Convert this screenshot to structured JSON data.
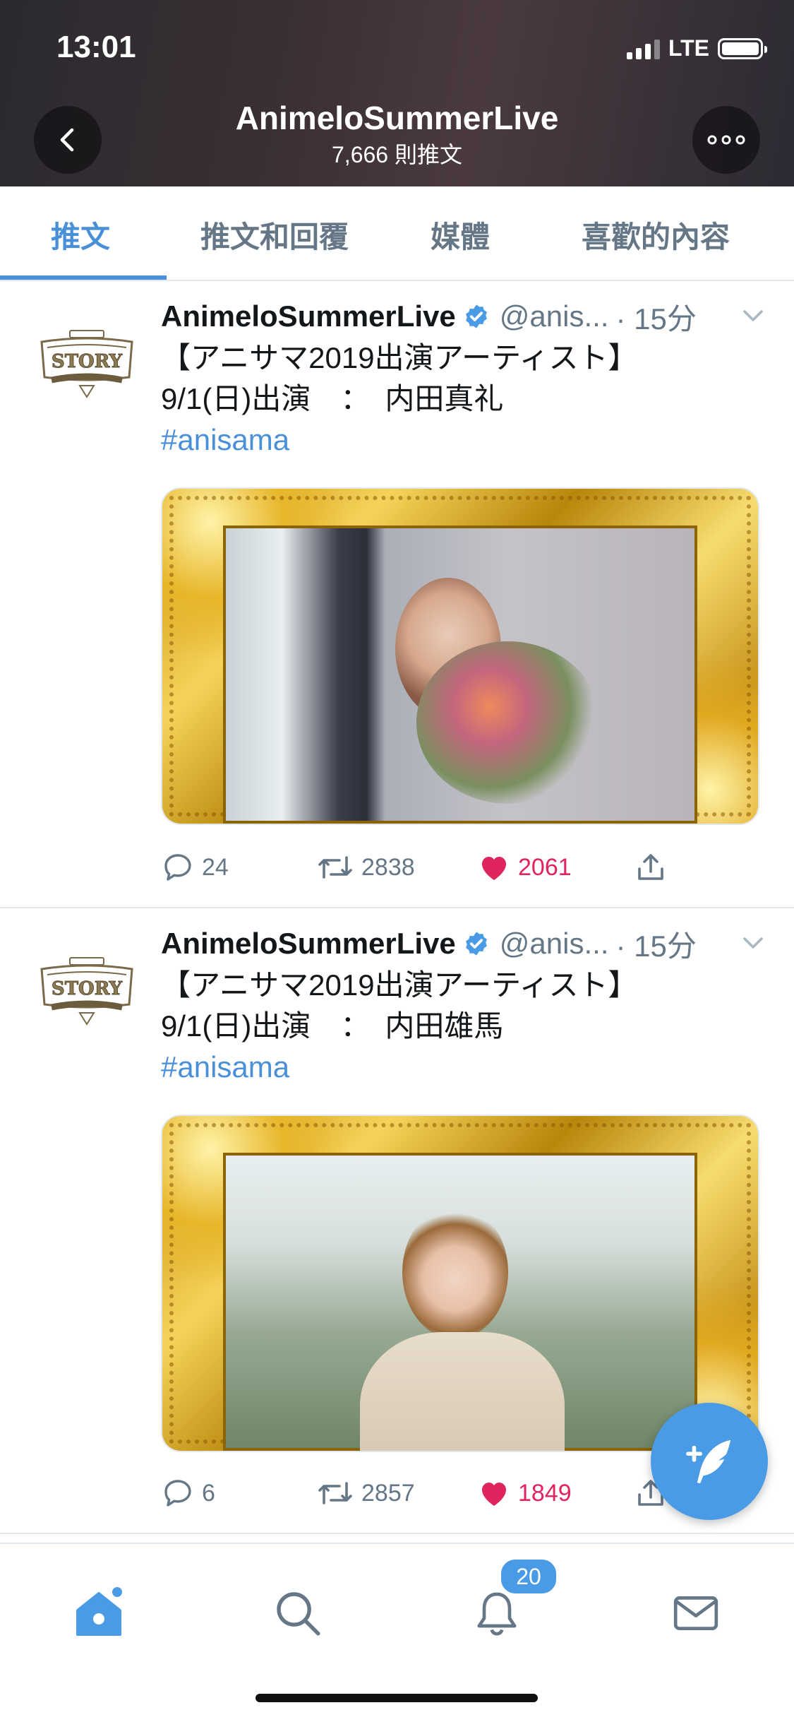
{
  "status_bar": {
    "time": "13:01",
    "network": "LTE"
  },
  "header": {
    "title": "AnimeloSummerLive",
    "subtitle": "7,666 則推文"
  },
  "tabs": [
    {
      "label": "推文",
      "active": true
    },
    {
      "label": "推文和回覆",
      "active": false
    },
    {
      "label": "媒體",
      "active": false
    },
    {
      "label": "喜歡的內容",
      "active": false
    }
  ],
  "tweets": [
    {
      "name": "AnimeloSummerLive",
      "handle": "@anis...",
      "time": "· 15分",
      "line1": "【アニサマ2019出演アーティスト】",
      "line2": "9/1(日)出演　：　内田真礼",
      "hashtag": "#anisama",
      "replies": "24",
      "retweets": "2838",
      "likes": "2061"
    },
    {
      "name": "AnimeloSummerLive",
      "handle": "@anis...",
      "time": "· 15分",
      "line1": "【アニサマ2019出演アーティスト】",
      "line2": "9/1(日)出演　：　内田雄馬",
      "hashtag": "#anisama",
      "replies": "6",
      "retweets": "2857",
      "likes": "1849"
    }
  ],
  "bottom_nav": {
    "notifications_badge": "20"
  },
  "colors": {
    "accent": "#4a90d9",
    "like": "#e0245e",
    "secondary_text": "#657786"
  },
  "icons": [
    "back-arrow-icon",
    "more-icon",
    "verified-icon",
    "chevron-down-icon",
    "reply-icon",
    "retweet-icon",
    "heart-icon",
    "share-icon",
    "compose-icon",
    "home-icon",
    "search-icon",
    "bell-icon",
    "mail-icon"
  ]
}
